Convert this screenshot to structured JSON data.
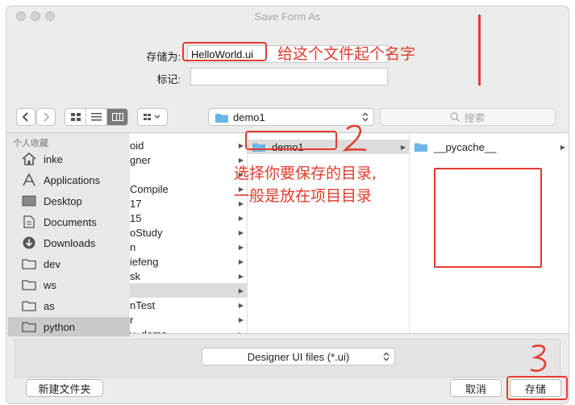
{
  "window": {
    "title": "Save Form As"
  },
  "form": {
    "save_as_label": "存储为:",
    "save_as_value": "HelloWorld.ui",
    "tags_label": "标记:",
    "tags_value": ""
  },
  "toolbar": {
    "path": "demo1",
    "search_placeholder": "搜索"
  },
  "sidebar": {
    "header": "个人收藏",
    "items": [
      {
        "label": "inke",
        "icon": "home-icon"
      },
      {
        "label": "Applications",
        "icon": "applications-icon"
      },
      {
        "label": "Desktop",
        "icon": "desktop-icon"
      },
      {
        "label": "Documents",
        "icon": "documents-icon"
      },
      {
        "label": "Downloads",
        "icon": "downloads-icon"
      },
      {
        "label": "dev",
        "icon": "folder-icon"
      },
      {
        "label": "ws",
        "icon": "folder-icon"
      },
      {
        "label": "as",
        "icon": "folder-icon"
      },
      {
        "label": "python",
        "icon": "folder-icon"
      }
    ]
  },
  "column1": {
    "items": [
      "oid",
      "gner",
      "",
      "Compile",
      "17",
      "15",
      "oStudy",
      "n",
      "iefeng",
      "sk",
      "",
      "nTest",
      "r",
      "y_demo"
    ]
  },
  "column2": {
    "items": [
      "demo1"
    ]
  },
  "column3": {
    "items": [
      "__pycache__"
    ]
  },
  "annotations": {
    "name_hint": "给这个文件起个名字",
    "dir_hint_line1": "选择你要保存的目录,",
    "dir_hint_line2": "一般是放在项目目录"
  },
  "footer": {
    "format": "Designer UI files (*.ui)",
    "new_folder": "新建文件夹",
    "cancel": "取消",
    "save": "存储"
  },
  "colors": {
    "accent": "#e33b2e",
    "folder": "#6cb4e8"
  }
}
